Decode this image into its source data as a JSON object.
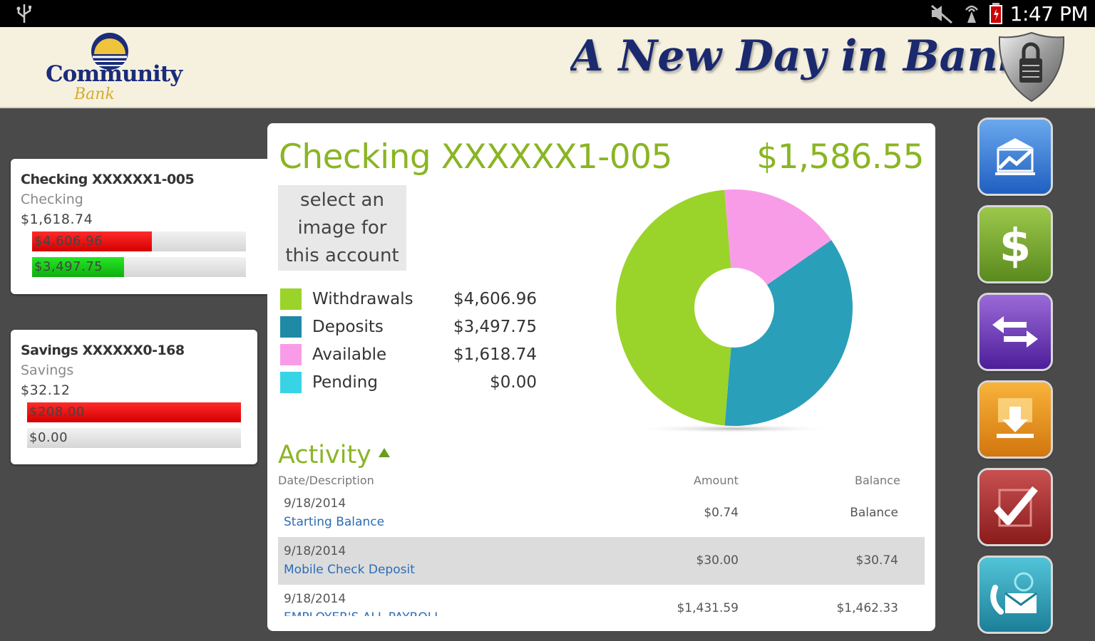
{
  "status_bar": {
    "time": "1:47 PM"
  },
  "header": {
    "logo_word": "Community",
    "logo_script": "Bank",
    "tagline": "A New Day in Banking"
  },
  "accounts": [
    {
      "name": "Checking XXXXXX1-005",
      "type": "Checking",
      "balance": "$1,618.74",
      "bars": [
        {
          "label": "$4,606.96",
          "fraction": 0.56,
          "color": "red"
        },
        {
          "label": "$3,497.75",
          "fraction": 0.43,
          "color": "green"
        }
      ]
    },
    {
      "name": "Savings XXXXXX0-168",
      "type": "Savings",
      "balance": "$32.12",
      "bars": [
        {
          "label": "$208.00",
          "fraction": 1.0,
          "color": "red"
        },
        {
          "label": "$0.00",
          "fraction": 0.0,
          "color": "green"
        }
      ]
    }
  ],
  "detail": {
    "title": "Checking XXXXXX1-005",
    "amount": "$1,586.55",
    "image_select": [
      "select an",
      "image for",
      "this account"
    ],
    "legend": [
      {
        "label": "Withdrawals",
        "value": "$4,606.96",
        "color": "#9ad32a"
      },
      {
        "label": "Deposits",
        "value": "$3,497.75",
        "color": "#1e8aa6"
      },
      {
        "label": "Available",
        "value": "$1,618.74",
        "color": "#f99ce8"
      },
      {
        "label": "Pending",
        "value": "$0.00",
        "color": "#37d4e6"
      }
    ]
  },
  "chart_data": {
    "type": "pie",
    "categories": [
      "Withdrawals",
      "Deposits",
      "Available",
      "Pending"
    ],
    "values": [
      4606.96,
      3497.75,
      1618.74,
      0.0
    ],
    "colors": [
      "#9ad32a",
      "#2a9fba",
      "#f99ce8",
      "#37d4e6"
    ],
    "title": "",
    "donut": true
  },
  "activity": {
    "title": "Activity",
    "headers": {
      "date_desc": "Date/Description",
      "amount": "Amount",
      "balance": "Balance"
    },
    "rows": [
      {
        "date": "9/18/2014",
        "description": "Starting Balance",
        "amount": "$0.74",
        "balance": "Balance"
      },
      {
        "date": "9/18/2014",
        "description": "Mobile Check Deposit",
        "amount": "$30.00",
        "balance": "$30.74"
      },
      {
        "date": "9/18/2014",
        "description": "EMPLOYER'S ALL PAYROLL",
        "amount": "$1,431.59",
        "balance": "$1,462.33"
      }
    ]
  },
  "nav_icons": [
    "accounts-chart-icon",
    "dollar-icon",
    "transfer-arrows-icon",
    "deposit-download-icon",
    "checkmark-icon",
    "contact-mail-icon"
  ]
}
